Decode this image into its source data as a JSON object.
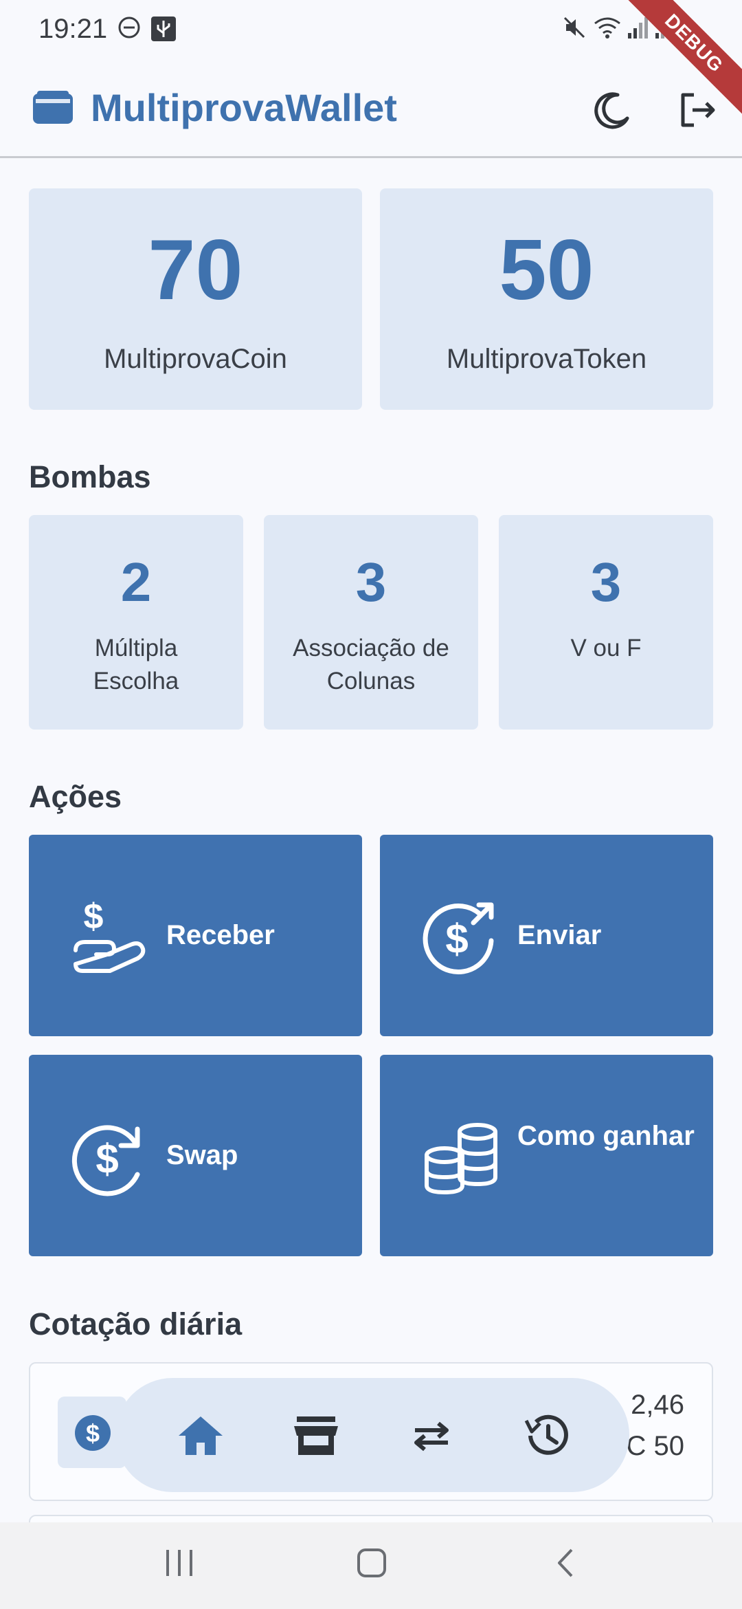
{
  "status": {
    "time": "19:21",
    "debug_label": "DEBUG"
  },
  "appbar": {
    "title": "MultiprovaWallet",
    "logo_icon": "wallet-icon",
    "theme_icon": "moon-icon",
    "logout_icon": "logout-icon"
  },
  "balances": [
    {
      "value": "70",
      "label": "MultiprovaCoin"
    },
    {
      "value": "50",
      "label": "MultiprovaToken"
    }
  ],
  "bombas": {
    "title": "Bombas",
    "items": [
      {
        "value": "2",
        "label": "Múltipla Escolha"
      },
      {
        "value": "3",
        "label": "Associação de Colunas"
      },
      {
        "value": "3",
        "label": "V ou F"
      }
    ]
  },
  "acoes": {
    "title": "Ações",
    "items": [
      {
        "label": "Receber",
        "icon": "hand-dollar-icon"
      },
      {
        "label": "Enviar",
        "icon": "send-dollar-icon"
      },
      {
        "label": "Swap",
        "icon": "swap-dollar-icon"
      },
      {
        "label": "Como ganhar",
        "icon": "coins-stack-icon"
      }
    ]
  },
  "cotacao": {
    "title": "Cotação diária",
    "line1": "2,46",
    "line2": "C 50"
  },
  "bottom_nav": [
    "home-icon",
    "store-icon",
    "swap-arrows-icon",
    "history-icon"
  ],
  "colors": {
    "accent": "#3f72ae",
    "card_bg": "#dfe8f5",
    "action_bg": "#4072b0",
    "debug": "#b53a3a"
  }
}
